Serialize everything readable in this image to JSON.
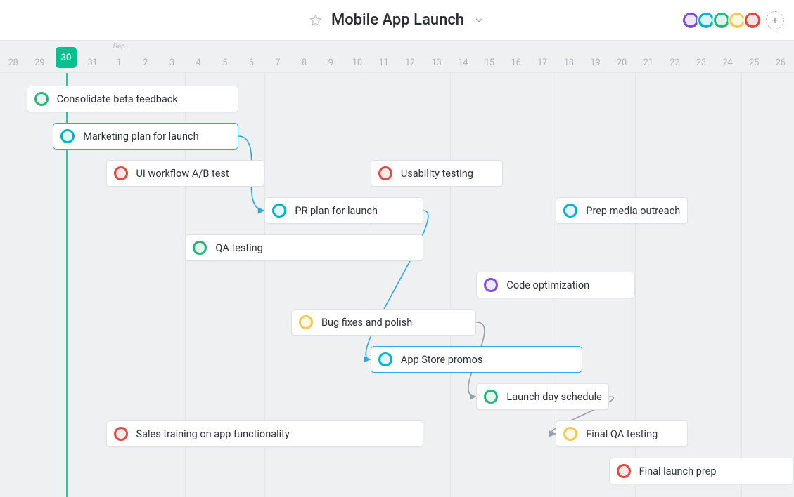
{
  "header": {
    "title": "Mobile App Launch",
    "collaborators": [
      {
        "color": "purple"
      },
      {
        "color": "teal"
      },
      {
        "color": "green"
      },
      {
        "color": "yellow"
      },
      {
        "color": "red"
      }
    ]
  },
  "colors": {
    "today": "#06c08e",
    "highlight": "#2ea7e0"
  },
  "timeline": {
    "month_label": "Sep",
    "month_label_day": "1",
    "current_day": "30",
    "days": [
      "28",
      "29",
      "30",
      "31",
      "1",
      "2",
      "3",
      "4",
      "5",
      "6",
      "7",
      "8",
      "9",
      "10",
      "11",
      "12",
      "13",
      "14",
      "15",
      "16",
      "17",
      "18",
      "19",
      "20",
      "21",
      "22",
      "23",
      "24",
      "25",
      "26"
    ]
  },
  "tasks": [
    {
      "id": "consolidate-beta-feedback",
      "label": "Consolidate beta feedback",
      "assignee_color": "green",
      "start_day": "29",
      "span_days": 8,
      "row": 0,
      "highlight": false
    },
    {
      "id": "marketing-plan",
      "label": "Marketing plan for launch",
      "assignee_color": "teal",
      "start_day": "30",
      "span_days": 7,
      "row": 1,
      "highlight": true
    },
    {
      "id": "ui-ab-test",
      "label": "UI workflow A/B test",
      "assignee_color": "red",
      "start_day": "1",
      "span_days": 6,
      "row": 2,
      "highlight": false
    },
    {
      "id": "usability-testing",
      "label": "Usability testing",
      "assignee_color": "red",
      "start_day": "11",
      "span_days": 5,
      "row": 2,
      "highlight": false
    },
    {
      "id": "pr-plan",
      "label": "PR plan for launch",
      "assignee_color": "teal",
      "start_day": "7",
      "span_days": 6,
      "row": 3,
      "highlight": false
    },
    {
      "id": "prep-media",
      "label": "Prep media outreach",
      "assignee_color": "teal",
      "start_day": "18",
      "span_days": 5,
      "row": 3,
      "highlight": false
    },
    {
      "id": "qa-testing",
      "label": "QA testing",
      "assignee_color": "green",
      "start_day": "4",
      "span_days": 9,
      "row": 4,
      "highlight": false
    },
    {
      "id": "code-optimization",
      "label": "Code optimization",
      "assignee_color": "purple",
      "start_day": "15",
      "span_days": 6,
      "row": 5,
      "highlight": false
    },
    {
      "id": "bug-fixes",
      "label": "Bug fixes and polish",
      "assignee_color": "yellow",
      "start_day": "8",
      "span_days": 7,
      "row": 6,
      "highlight": false
    },
    {
      "id": "app-store-promos",
      "label": "App Store promos",
      "assignee_color": "teal",
      "start_day": "11",
      "span_days": 8,
      "row": 7,
      "highlight": true
    },
    {
      "id": "launch-day-schedule",
      "label": "Launch day schedule",
      "assignee_color": "green",
      "start_day": "15",
      "span_days": 5,
      "row": 8,
      "highlight": false
    },
    {
      "id": "sales-training",
      "label": "Sales training on app functionality",
      "assignee_color": "red",
      "start_day": "1",
      "span_days": 12,
      "row": 9,
      "highlight": false
    },
    {
      "id": "final-qa",
      "label": "Final QA testing",
      "assignee_color": "yellow",
      "start_day": "18",
      "span_days": 5,
      "row": 9,
      "highlight": false
    },
    {
      "id": "final-launch-prep",
      "label": "Final launch prep",
      "assignee_color": "red",
      "start_day": "20",
      "span_days": 7,
      "row": 10,
      "highlight": false
    }
  ],
  "dependencies": [
    {
      "from": "marketing-plan",
      "to": "pr-plan",
      "color": "#2ea7e0"
    },
    {
      "from": "pr-plan",
      "to": "app-store-promos",
      "color": "#2ea7e0"
    },
    {
      "from": "bug-fixes",
      "to": "launch-day-schedule",
      "color": "#9aa0a6"
    },
    {
      "from": "launch-day-schedule",
      "to": "final-qa",
      "color": "#9aa0a6"
    }
  ]
}
